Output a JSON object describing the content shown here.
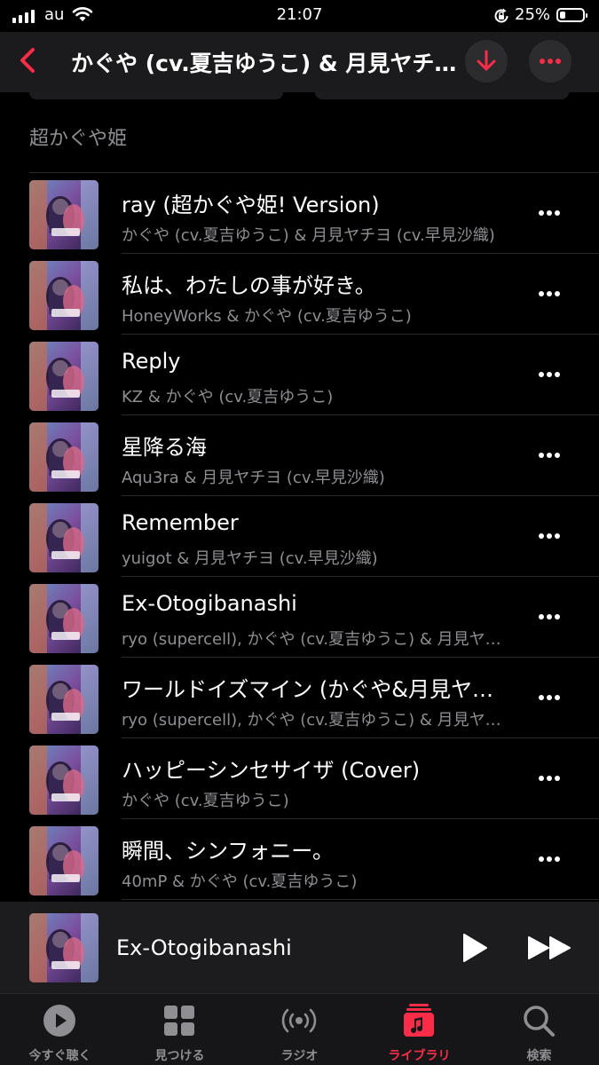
{
  "status_bar": {
    "carrier": "au",
    "time": "21:07",
    "battery_percent": "25%",
    "battery_level": 0.25
  },
  "nav": {
    "title": "かぐや (cv.夏吉ゆうこ) & 月見ヤチヨ (cv.早見沙織)",
    "back_icon": "chevron-left-icon",
    "download_icon": "download-arrow-icon",
    "more_icon": "ellipsis-icon"
  },
  "section_title": "超かぐや姫",
  "tracks": [
    {
      "title": "ray (超かぐや姫! Version)",
      "artist": "かぐや (cv.夏吉ゆうこ) & 月見ヤチヨ (cv.早見沙織)"
    },
    {
      "title": "私は、わたしの事が好き。",
      "artist": "HoneyWorks & かぐや (cv.夏吉ゆうこ)"
    },
    {
      "title": "Reply",
      "artist": "KZ & かぐや (cv.夏吉ゆうこ)"
    },
    {
      "title": "星降る海",
      "artist": "Aqu3ra & 月見ヤチヨ (cv.早見沙織)"
    },
    {
      "title": "Remember",
      "artist": "yuigot & 月見ヤチヨ (cv.早見沙織)"
    },
    {
      "title": "Ex-Otogibanashi",
      "artist": "ryo (supercell), かぐや (cv.夏吉ゆうこ) & 月見ヤチヨ"
    },
    {
      "title": "ワールドイズマイン (かぐや&月見ヤチヨ)",
      "artist": "ryo (supercell), かぐや (cv.夏吉ゆうこ) & 月見ヤチヨ"
    },
    {
      "title": "ハッピーシンセサイザ (Cover)",
      "artist": "かぐや (cv.夏吉ゆうこ)"
    },
    {
      "title": "瞬間、シンフォニー。",
      "artist": "40mP & かぐや (cv.夏吉ゆうこ)"
    }
  ],
  "mini_player": {
    "title": "Ex-Otogibanashi",
    "play_icon": "play-icon",
    "forward_icon": "fast-forward-icon"
  },
  "tab_bar": {
    "tabs": [
      {
        "label": "今すぐ聴く",
        "icon": "play-circle-icon",
        "active": false
      },
      {
        "label": "見つける",
        "icon": "grid-icon",
        "active": false
      },
      {
        "label": "ラジオ",
        "icon": "radio-broadcast-icon",
        "active": false
      },
      {
        "label": "ライブラリ",
        "icon": "music-library-icon",
        "active": true
      },
      {
        "label": "検索",
        "icon": "search-icon",
        "active": false
      }
    ]
  },
  "colors": {
    "accent": "#fa2d48",
    "background": "#000000",
    "secondary_text": "#8e8e93"
  }
}
